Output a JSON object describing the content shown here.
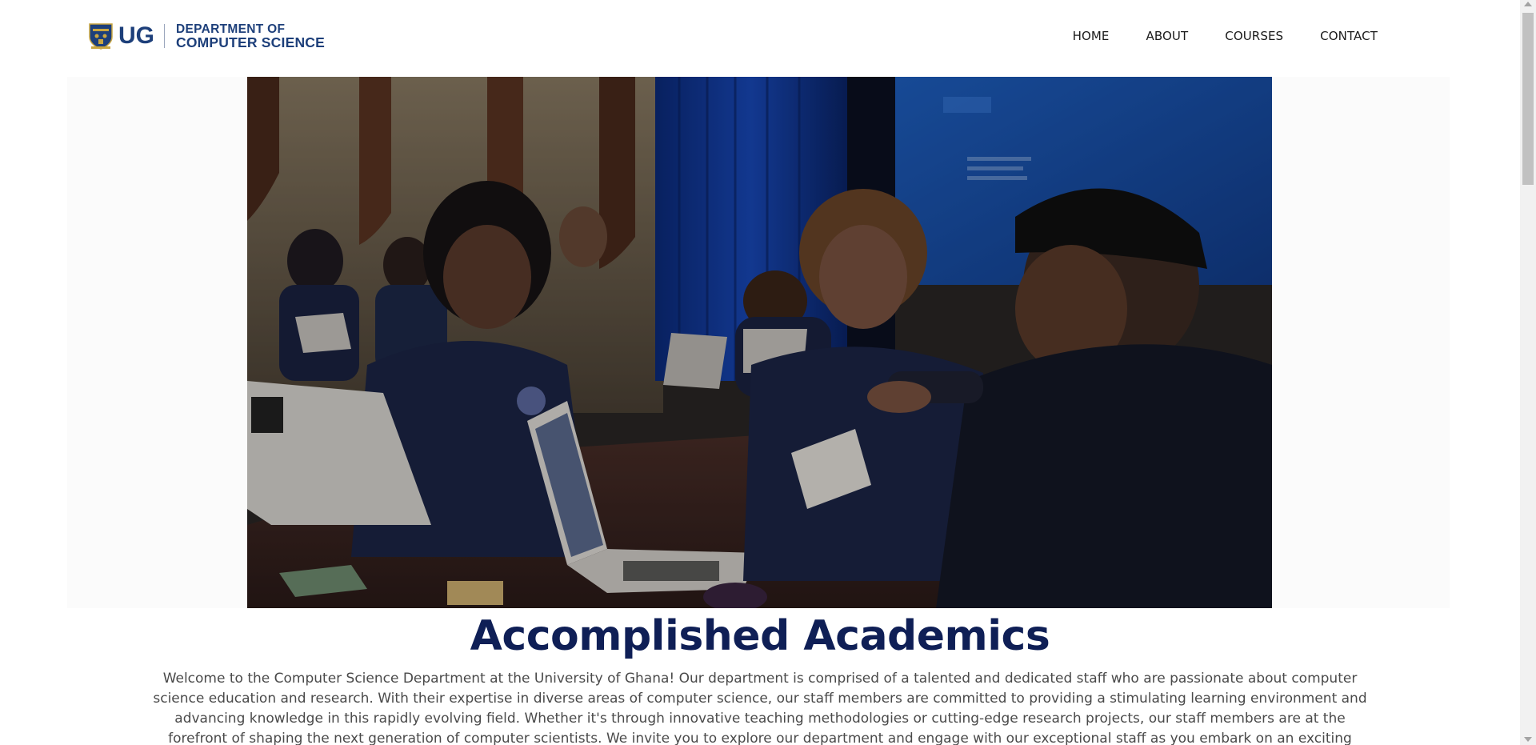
{
  "header": {
    "logo_mark": "UG",
    "logo_line1": "DEPARTMENT OF",
    "logo_line2": "COMPUTER SCIENCE",
    "nav": [
      "HOME",
      "ABOUT",
      "COURSES",
      "CONTACT"
    ]
  },
  "hero": {
    "image_subject": "students working on laptops in a classroom with a mentor"
  },
  "main": {
    "headline": "Accomplished Academics",
    "intro": "Welcome to the Computer Science Department at the University of Ghana! Our department is comprised of a talented and dedicated staff who are passionate about computer science education and research. With their expertise in diverse areas of computer science, our staff members are committed to providing a stimulating learning environment and advancing knowledge in this rapidly evolving field. Whether it's through innovative teaching methodologies or cutting-edge research projects, our staff members are at the forefront of shaping the next generation of computer scientists. We invite you to explore our department and engage with our exceptional staff as you embark on an exciting journey in computer science."
  },
  "colors": {
    "brand_navy": "#0f1f56",
    "logo_blue": "#1d3f7a",
    "body_text": "#4a4a4a"
  },
  "icons": [
    "crest-icon",
    "scroll-up-icon",
    "scroll-down-icon"
  ]
}
